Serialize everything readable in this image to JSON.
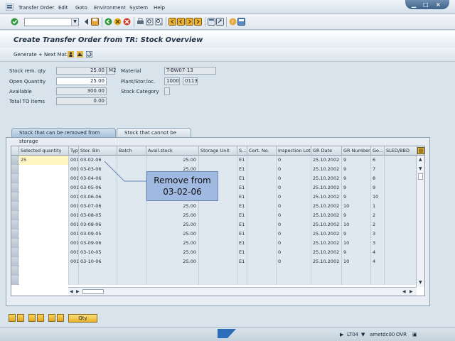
{
  "menu": {
    "items": [
      "Transfer Order",
      "Edit",
      "Goto",
      "Environment",
      "System",
      "Help"
    ]
  },
  "title": "Create Transfer Order from TR: Stock Overview",
  "app_toolbar": {
    "generate_label": "Generate + Next Mat."
  },
  "form": {
    "stock_rem_qty": {
      "label": "Stock rem. qty",
      "value": "25.00",
      "unit": "M2"
    },
    "open_quantity": {
      "label": "Open Quantity",
      "value": "25.00"
    },
    "available": {
      "label": "Available",
      "value": "300.00"
    },
    "total_to_items": {
      "label": "Total TO items",
      "value": "0.00"
    },
    "material": {
      "label": "Material",
      "value": "T-BW07-13"
    },
    "plant_stor": {
      "label": "Plant/Stor.loc.",
      "plant": "1000",
      "sloc": "0113"
    },
    "stock_category": {
      "label": "Stock Category",
      "value": ""
    }
  },
  "tabs": [
    {
      "label": "Stock that can be removed from storage",
      "active": true
    },
    {
      "label": "Stock that cannot be picked",
      "active": false
    }
  ],
  "table": {
    "columns": [
      "Selected quantity",
      "Typ",
      "Stor. Bin",
      "Batch",
      "Avail.stock",
      "Storage Unit",
      "S...",
      "Cert. No.",
      "Inspection Lot",
      "GR Date",
      "GR Number",
      "Go...",
      "SLED/BBD"
    ],
    "rows": [
      {
        "qty": "25",
        "typ": "001",
        "bin": "03-02-06",
        "avail": "25.00",
        "s": "E1",
        "insp": "0",
        "gr_date": "25.10.2002",
        "gr_no": "9",
        "go": "6"
      },
      {
        "qty": "",
        "typ": "001",
        "bin": "03-03-06",
        "avail": "25.00",
        "s": "E1",
        "insp": "0",
        "gr_date": "25.10.2002",
        "gr_no": "9",
        "go": "7"
      },
      {
        "qty": "",
        "typ": "001",
        "bin": "03-04-06",
        "avail": "25.00",
        "s": "E1",
        "insp": "0",
        "gr_date": "25.10.2002",
        "gr_no": "9",
        "go": "8"
      },
      {
        "qty": "",
        "typ": "001",
        "bin": "03-05-06",
        "avail": "25.00",
        "s": "E1",
        "insp": "0",
        "gr_date": "25.10.2002",
        "gr_no": "9",
        "go": "9"
      },
      {
        "qty": "",
        "typ": "001",
        "bin": "03-06-06",
        "avail": "25.00",
        "s": "E1",
        "insp": "0",
        "gr_date": "25.10.2002",
        "gr_no": "9",
        "go": "10"
      },
      {
        "qty": "",
        "typ": "001",
        "bin": "03-07-06",
        "avail": "25.00",
        "s": "E1",
        "insp": "0",
        "gr_date": "25.10.2002",
        "gr_no": "10",
        "go": "1"
      },
      {
        "qty": "",
        "typ": "001",
        "bin": "03-08-05",
        "avail": "25.00",
        "s": "E1",
        "insp": "0",
        "gr_date": "25.10.2002",
        "gr_no": "9",
        "go": "2"
      },
      {
        "qty": "",
        "typ": "001",
        "bin": "03-08-06",
        "avail": "25.00",
        "s": "E1",
        "insp": "0",
        "gr_date": "25.10.2002",
        "gr_no": "10",
        "go": "2"
      },
      {
        "qty": "",
        "typ": "001",
        "bin": "03-09-05",
        "avail": "25.00",
        "s": "E1",
        "insp": "0",
        "gr_date": "25.10.2002",
        "gr_no": "9",
        "go": "3"
      },
      {
        "qty": "",
        "typ": "001",
        "bin": "03-09-06",
        "avail": "25.00",
        "s": "E1",
        "insp": "0",
        "gr_date": "25.10.2002",
        "gr_no": "10",
        "go": "3"
      },
      {
        "qty": "",
        "typ": "001",
        "bin": "03-10-05",
        "avail": "25.00",
        "s": "E1",
        "insp": "0",
        "gr_date": "25.10.2002",
        "gr_no": "9",
        "go": "4"
      },
      {
        "qty": "",
        "typ": "001",
        "bin": "03-10-06",
        "avail": "25.00",
        "s": "E1",
        "insp": "0",
        "gr_date": "25.10.2002",
        "gr_no": "10",
        "go": "4"
      }
    ]
  },
  "callout": {
    "line1": "Remove from",
    "line2": "03-02-06"
  },
  "bottom": {
    "qty_label": "Qty"
  },
  "status": {
    "transaction": "LT04",
    "server": "ametdc00",
    "mode": "OVR"
  },
  "colors": {
    "accent": "#a8c2da",
    "callout": "#9fb9e0",
    "selected": "#fff6c2"
  }
}
